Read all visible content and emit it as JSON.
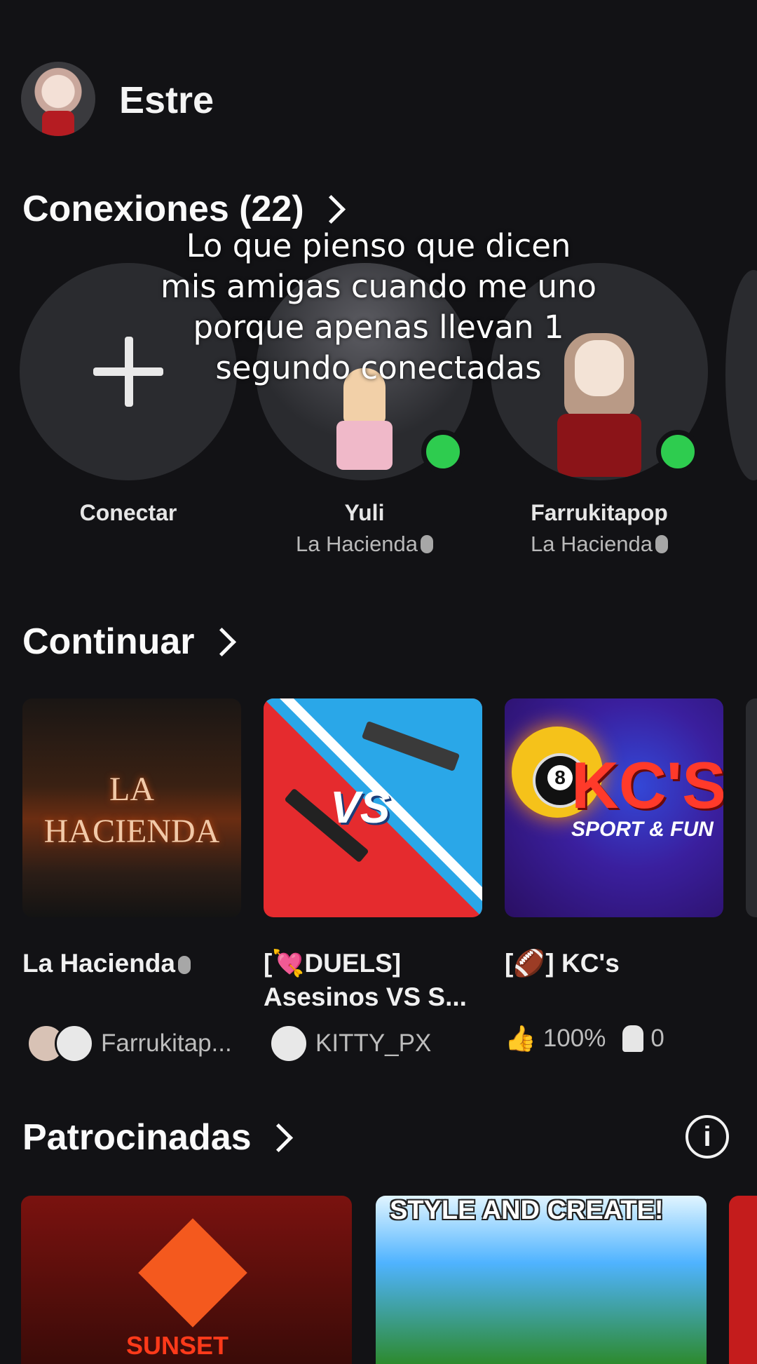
{
  "profile": {
    "username": "Estre"
  },
  "connections": {
    "title": "Conexiones (22)",
    "items": [
      {
        "name": "Conectar",
        "status": ""
      },
      {
        "name": "Yuli",
        "status": "La Hacienda"
      },
      {
        "name": "Farrukitapop",
        "status": "La Hacienda"
      }
    ]
  },
  "overlay": {
    "lines": [
      "Lo que pienso que dicen",
      "mis amigas cuando me uno",
      "porque apenas llevan 1",
      "segundo conectadas"
    ]
  },
  "continue": {
    "title": "Continuar",
    "games": [
      {
        "title": "La Hacienda",
        "thumb_text": "LA HACIENDA",
        "meta": "Farrukitap..."
      },
      {
        "title": "[💘DUELS] Asesinos VS S...",
        "thumb_text": "VS",
        "meta": "KITTY_PX"
      },
      {
        "title": "[🏈] KC's",
        "thumb_text": "KC'S",
        "thumb_subtext": "SPORT & FUN",
        "rating": "100%",
        "players": "0"
      }
    ]
  },
  "sponsored": {
    "title": "Patrocinadas",
    "ads": [
      {
        "label": "SUNSET"
      },
      {
        "label": "STYLE AND CREATE!"
      }
    ]
  }
}
